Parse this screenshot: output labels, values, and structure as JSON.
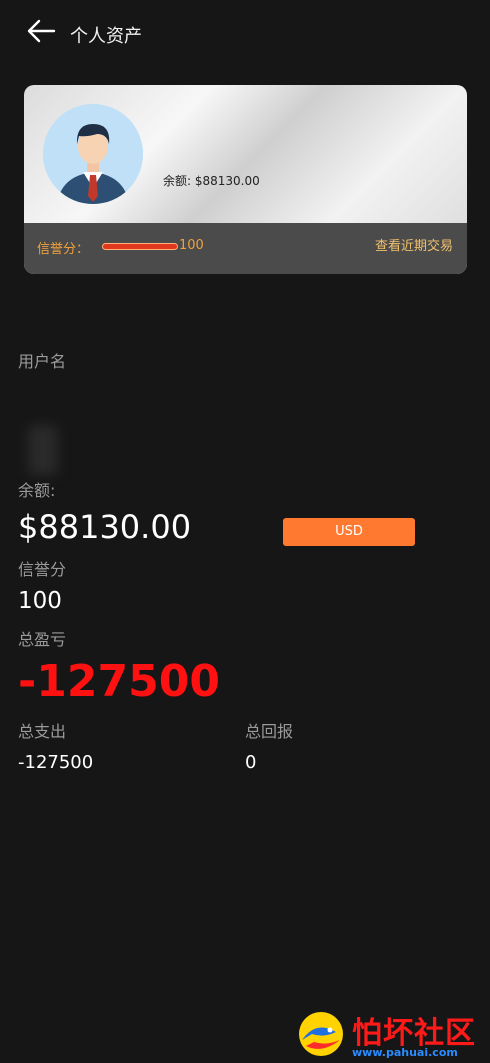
{
  "header": {
    "title": "个人资产",
    "back_icon": "arrow-left-icon"
  },
  "card": {
    "avatar_icon": "businessman-avatar-icon",
    "balance_label": "余额:",
    "balance_value": "$88130.00",
    "credit_label": "信誉分：",
    "credit_value": "100",
    "credit_fraction": 1.0,
    "recent_link": "查看近期交易"
  },
  "username": {
    "label": "用户名",
    "value": ""
  },
  "balance": {
    "label": "余额:",
    "value": "$88130.00",
    "currency_button": "USD"
  },
  "credit": {
    "label": "信誉分",
    "value": "100"
  },
  "pnl": {
    "label": "总盈亏",
    "value": "-127500"
  },
  "expense": {
    "label": "总支出",
    "value": "-127500"
  },
  "returns": {
    "label": "总回报",
    "value": "0"
  },
  "watermark": {
    "text": "怕坏社区",
    "url": "www.pahuai.com"
  },
  "colors": {
    "background": "#161616",
    "accent": "#ff7a30",
    "negative": "#ff1111",
    "credit": "#f0a23c"
  }
}
